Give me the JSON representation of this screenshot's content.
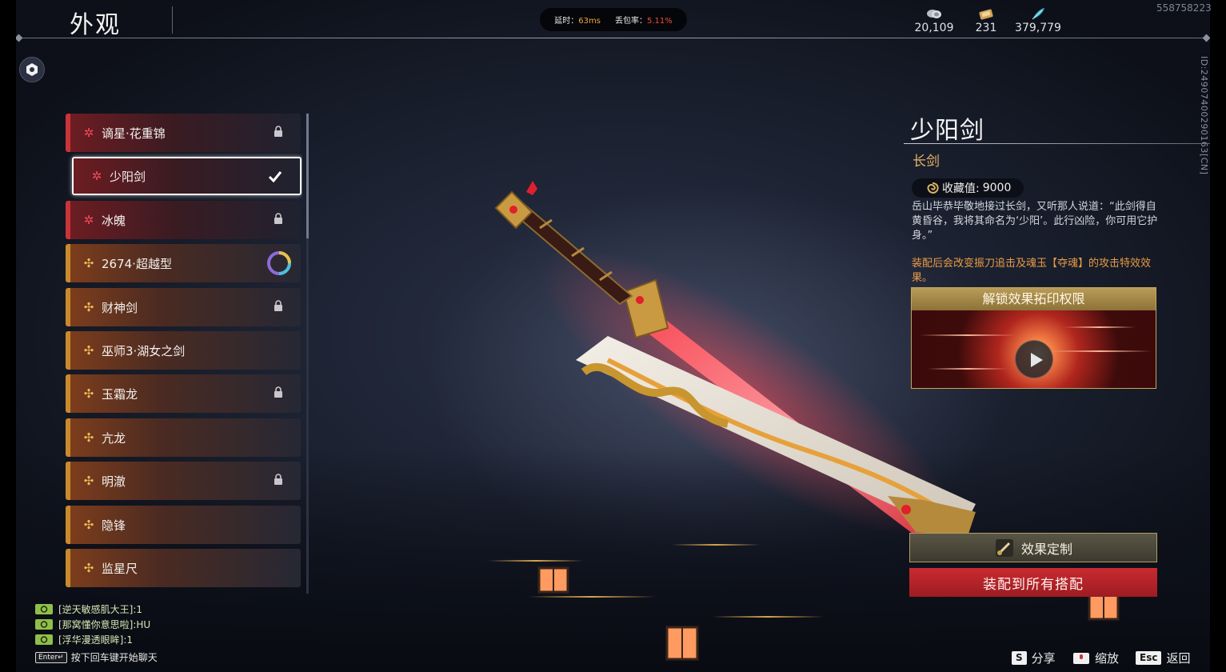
{
  "header": {
    "title": "外观",
    "network": {
      "latency_label": "延时：",
      "latency_value": "63ms",
      "loss_label": "丢包率：",
      "loss_value": "5.11%"
    },
    "currencies": [
      {
        "icon": "coin-stack-icon",
        "value": "20,109"
      },
      {
        "icon": "ticket-icon",
        "value": "231"
      },
      {
        "icon": "feather-icon",
        "value": "379,779"
      }
    ],
    "uid": "558758223",
    "vertical_id": "ID:249074002901​63[CN]"
  },
  "skin_list": {
    "items": [
      {
        "name": "谪星·花重锦",
        "rarity": "red",
        "status": "locked"
      },
      {
        "name": "少阳剑",
        "rarity": "red",
        "status": "equipped",
        "selected": true
      },
      {
        "name": "冰魄",
        "rarity": "red",
        "status": "locked"
      },
      {
        "name": "2674·超越型",
        "rarity": "gold",
        "status": "special"
      },
      {
        "name": "财神剑",
        "rarity": "gold",
        "status": "locked"
      },
      {
        "name": "巫师3·湖女之剑",
        "rarity": "gold",
        "status": "none"
      },
      {
        "name": "玉霜龙",
        "rarity": "gold",
        "status": "locked"
      },
      {
        "name": "亢龙",
        "rarity": "gold",
        "status": "none"
      },
      {
        "name": "明澈",
        "rarity": "gold",
        "status": "locked"
      },
      {
        "name": "隐锋",
        "rarity": "gold",
        "status": "none"
      },
      {
        "name": "监星尺",
        "rarity": "gold",
        "status": "none"
      }
    ],
    "scroll_fraction": 0.26
  },
  "detail": {
    "name": "少阳剑",
    "type": "长剑",
    "collection_label": "收藏值:",
    "collection_value": "9000",
    "description": "岳山毕恭毕敬地接过长剑，又听那人说道：“此剑得自黄昏谷，我将其命名为‘少阳’。此行凶险，你可用它护身。”",
    "effect_note": "装配后会改变振刀追击及魂玉【夺魂】的攻击特效效果。",
    "video_title": "解锁效果拓印权限",
    "effect_custom_label": "效果定制",
    "equip_all_label": "装配到所有搭配"
  },
  "chat": {
    "messages": [
      {
        "text": "[逆天敏感肌大王]:1"
      },
      {
        "text": "[那窝懂你意思啦]:HU"
      },
      {
        "text": "[浮华漫透眼眸]:1"
      }
    ],
    "enter_key": "Enter↵",
    "hint": "按下回车键开始聊天"
  },
  "footer": {
    "hotkeys": [
      {
        "key": "S",
        "label": "分享"
      },
      {
        "key": "",
        "label": "缩放"
      },
      {
        "key": "Esc",
        "label": "返回"
      }
    ]
  },
  "colors": {
    "accent_red": "#c92b30",
    "accent_gold": "#c98a2c",
    "effect_orange": "#e99b45",
    "type_gold": "#e7b468"
  }
}
